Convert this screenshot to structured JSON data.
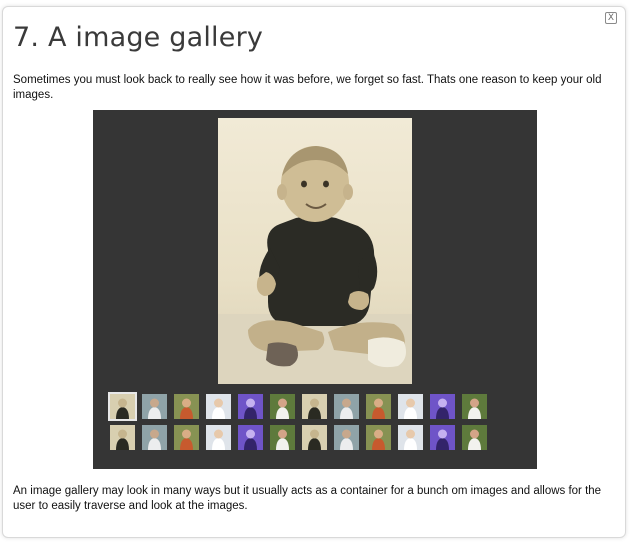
{
  "window": {
    "close_label": "X"
  },
  "article": {
    "title": "7. A image gallery",
    "intro": "Sometimes you must look back to really see how it was before, we forget so fast. Thats one reason to keep your old images.",
    "outro": "An image gallery may look in many ways but it usually acts as a container for a bunch om images and allows for the user to easily traverse and look at the images."
  },
  "gallery": {
    "background": "#353535",
    "main_image": {
      "subject": "baby-portrait-sepia"
    },
    "thumbnail_rows": [
      [
        "sepia-baby",
        "blue-toddler",
        "green-child",
        "white-baby",
        "purple-kid",
        "garden-child",
        "sepia-baby",
        "blue-toddler",
        "green-child",
        "white-baby",
        "purple-kid",
        "garden-child"
      ],
      [
        "sepia-baby",
        "blue-toddler",
        "green-child",
        "white-baby",
        "purple-kid",
        "garden-child",
        "sepia-baby",
        "blue-toddler",
        "green-child",
        "white-baby",
        "purple-kid",
        "garden-child"
      ]
    ],
    "selected": {
      "row": 1,
      "index": 1
    },
    "palettes": {
      "sepia-baby": {
        "bg": "#d8cfb0",
        "fig": "#2a2a22",
        "skin": "#c6b58e"
      },
      "blue-toddler": {
        "bg": "#8fa3a8",
        "fig": "#ecedee",
        "skin": "#c7a88c"
      },
      "green-child": {
        "bg": "#879253",
        "fig": "#c75a2e",
        "skin": "#d8ad86"
      },
      "white-baby": {
        "bg": "#dfe4ea",
        "fig": "#ffffff",
        "skin": "#e7c9ab"
      },
      "purple-kid": {
        "bg": "#6f54c8",
        "fig": "#33246a",
        "skin": "#c5b1f0"
      },
      "garden-child": {
        "bg": "#5e7a3c",
        "fig": "#f2f2ee",
        "skin": "#d3a488"
      }
    }
  }
}
